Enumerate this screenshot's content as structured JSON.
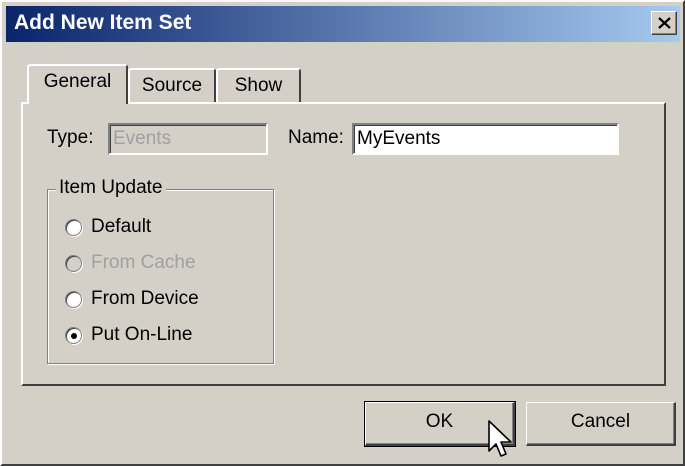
{
  "window": {
    "title": "Add New Item Set",
    "close_glyph": "×"
  },
  "tabs": [
    {
      "label": "General",
      "active": true
    },
    {
      "label": "Source",
      "active": false
    },
    {
      "label": "Show",
      "active": false
    }
  ],
  "general": {
    "type_label": "Type:",
    "type_value": "Events",
    "name_label": "Name:",
    "name_value": "MyEvents"
  },
  "item_update": {
    "legend": "Item Update",
    "options": [
      {
        "label": "Default",
        "checked": false,
        "enabled": true
      },
      {
        "label": "From Cache",
        "checked": false,
        "enabled": false
      },
      {
        "label": "From Device",
        "checked": false,
        "enabled": true
      },
      {
        "label": "Put On-Line",
        "checked": true,
        "enabled": true
      }
    ]
  },
  "buttons": {
    "ok": "OK",
    "cancel": "Cancel"
  },
  "colors": {
    "face": "#d4d0c8",
    "title_start": "#0a246a",
    "title_end": "#a6caf0",
    "disabled_text": "#a0a0a0"
  }
}
